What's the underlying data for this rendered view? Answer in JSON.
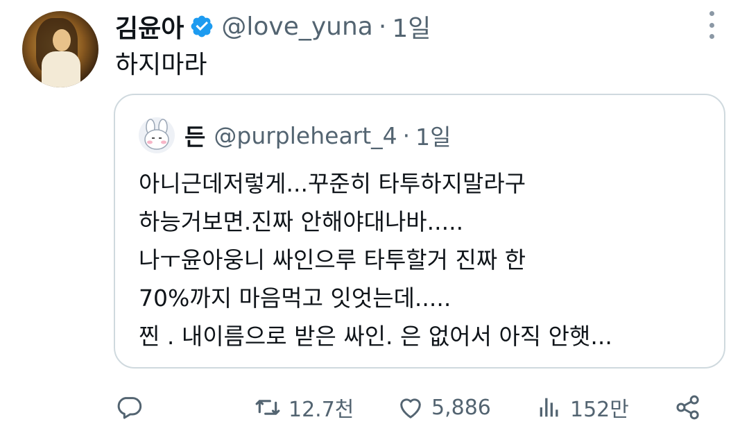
{
  "tweet": {
    "author_name": "김윤아",
    "handle": "@love_yuna",
    "separator": "·",
    "time": "1일",
    "text": "하지마라"
  },
  "quote": {
    "author_name": "든",
    "handle": "@purpleheart_4",
    "separator": "·",
    "time": "1일",
    "lines": [
      "아니근데저렇게...꾸준히 타투하지말라구",
      "하능거보면.진짜 안해야대나바.....",
      "나ㅜ윤아웅니 싸인으루 타투할거 진짜 한",
      "70%까지 마음먹고 잇엇는데.....",
      "찐 . 내이름으로 받은 싸인. 은 없어서 아직 안햇..."
    ]
  },
  "actions": {
    "reply_count": "",
    "retweet_count": "12.7천",
    "like_count": "5,886",
    "view_count": "152만"
  },
  "icons": {
    "verified": "verified-badge-icon",
    "more": "more-vertical-icon",
    "reply": "reply-icon",
    "retweet": "retweet-icon",
    "like": "heart-icon",
    "views": "views-icon",
    "share": "share-icon"
  },
  "colors": {
    "text": "#0f1419",
    "secondary": "#536471",
    "verified": "#1d9bf0",
    "border": "#cfd9de"
  }
}
